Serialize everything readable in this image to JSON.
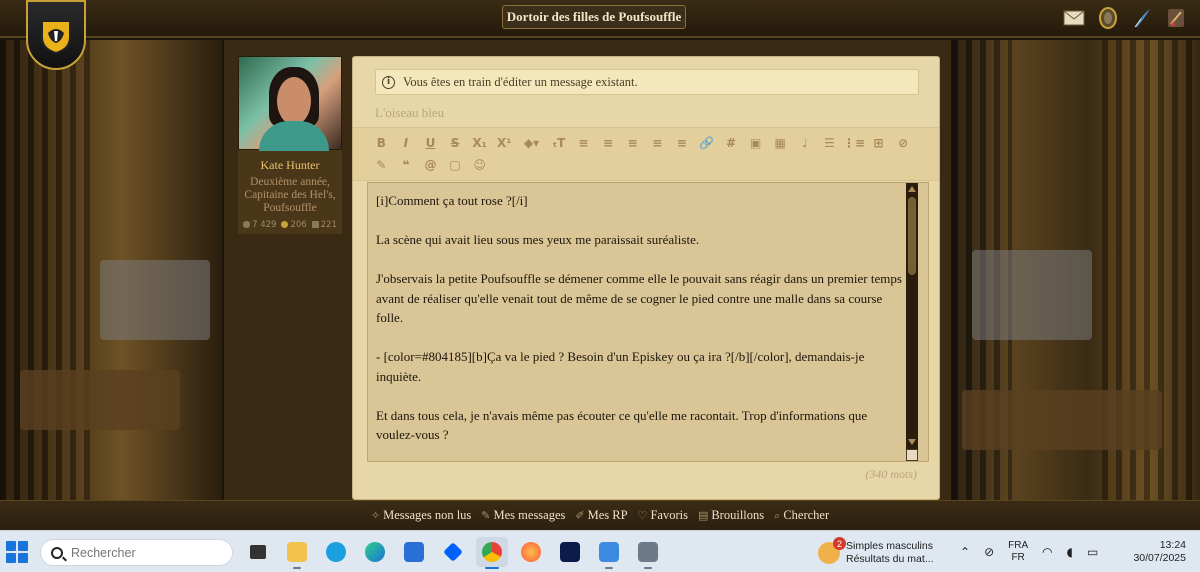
{
  "header": {
    "page_title": "Dortoir des filles de Poufsouffle",
    "icons": [
      "envelope-icon",
      "portrait-frame-icon",
      "quill-icon",
      "broom-icon"
    ]
  },
  "character": {
    "name": "Kate Hunter",
    "rank": "Deuxième année, Capitaine des Hel's, Poufsouffle",
    "stats": {
      "posts": "7 429",
      "coins": "206",
      "points": "221"
    }
  },
  "editor": {
    "notice": "Vous êtes en train d'éditer un message existant.",
    "subject_placeholder": "L'oiseau bleu",
    "toolbar_row1": [
      "B",
      "I",
      "U",
      "S",
      "X₁",
      "X¹",
      "◆▾",
      "ₜT",
      "≡",
      "≡",
      "≡",
      "≡",
      "≡",
      "🔗",
      "#",
      "▣",
      "▦",
      "♩",
      "☰",
      "⋮≡",
      "⊞",
      "⊘"
    ],
    "toolbar_row2": [
      "✎",
      "❝",
      "@",
      "▢",
      "☺"
    ],
    "message_paragraphs": [
      "[i]Comment ça tout rose ?[/i]",
      "La scène qui avait lieu sous mes yeux me paraissait suréaliste.",
      "J'observais la petite Poufsouffle se démener comme elle le pouvait sans réagir dans un premier temps avant de réaliser qu'elle venait tout de même de se cogner le pied contre une malle dans sa course folle.",
      "- [color=#804185][b]Ça va le pied ? Besoin d'un Episkey ou ça ira ?[/b][/color], demandais-je inquiète.",
      "Et dans tous cela, je n'avais même pas écouter ce qu'elle me racontait. Trop d'informations que voulez-vous ?"
    ],
    "word_count": "(340 mots)"
  },
  "bottom_nav": [
    {
      "label": "Messages non lus",
      "icon": "sparkle-icon"
    },
    {
      "label": "Mes messages",
      "icon": "quill-icon"
    },
    {
      "label": "Mes RP",
      "icon": "feather-icon"
    },
    {
      "label": "Favoris",
      "icon": "heart-icon"
    },
    {
      "label": "Brouillons",
      "icon": "drafts-icon"
    },
    {
      "label": "Chercher",
      "icon": "search-icon"
    }
  ],
  "taskbar": {
    "search_placeholder": "Rechercher",
    "notification": {
      "count": "2",
      "title": "Simples masculins",
      "subtitle": "Résultats du mat..."
    },
    "lang_top": "FRA",
    "lang_bottom": "FR",
    "time": "13:24",
    "date": "30/07/2025"
  },
  "colors": {
    "accent_gold": "#e8c46a",
    "parchment": "#e7d6a8",
    "start_blue": "#1a73d9"
  }
}
